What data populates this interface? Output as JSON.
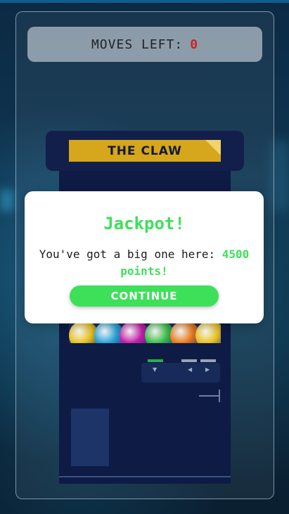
{
  "hud": {
    "moves_label": "MOVES LEFT:",
    "moves_value": "0",
    "moves_value_color": "#c82626"
  },
  "machine": {
    "title": "THE CLAW",
    "marquee_color": "#d6a61c",
    "body_color": "#0e1b45",
    "ball_colors": [
      "#e8c21f",
      "#2aa3d8",
      "#c41ea8",
      "#3bbf4a",
      "#e87a1c"
    ]
  },
  "dialog": {
    "title": "Jackpot!",
    "message_prefix": "You've got a big one here:",
    "points_text": "4500 points!",
    "continue_label": "CONTINUE",
    "accent_color": "#3ee05a"
  }
}
